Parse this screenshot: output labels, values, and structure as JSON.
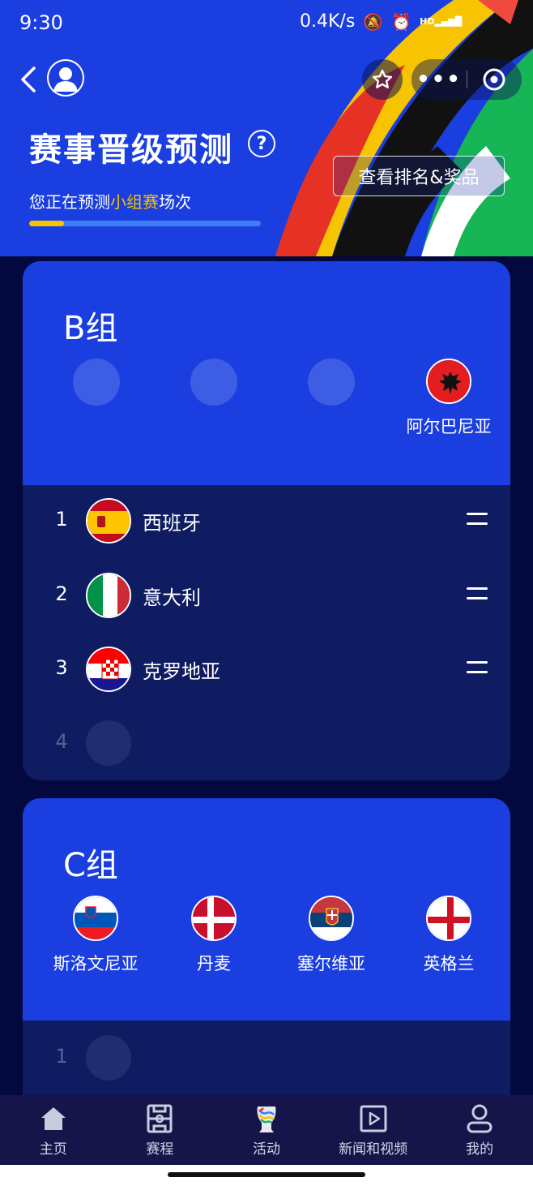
{
  "status_bar": {
    "time": "9:30",
    "speed": "0.4K/s",
    "signal_label": "HD"
  },
  "header": {
    "title": "赛事晋级预测",
    "subtitle_prefix": "您正在预测",
    "subtitle_highlight": "小组赛",
    "subtitle_suffix": "场次",
    "progress_fraction": 0.15,
    "rank_button": "查看排名&奖品"
  },
  "groups": [
    {
      "title": "B组",
      "remaining_teams": [
        {
          "name": "阿尔巴尼亚",
          "flag": "albania"
        }
      ],
      "ranking": [
        {
          "rank": "1",
          "name": "西班牙",
          "flag": "spain"
        },
        {
          "rank": "2",
          "name": "意大利",
          "flag": "italy"
        },
        {
          "rank": "3",
          "name": "克罗地亚",
          "flag": "croatia"
        },
        {
          "rank": "4",
          "name": "",
          "flag": ""
        }
      ]
    },
    {
      "title": "C组",
      "remaining_teams": [
        {
          "name": "斯洛文尼亚",
          "flag": "slovenia"
        },
        {
          "name": "丹麦",
          "flag": "denmark"
        },
        {
          "name": "塞尔维亚",
          "flag": "serbia"
        },
        {
          "name": "英格兰",
          "flag": "england"
        }
      ],
      "ranking": [
        {
          "rank": "1",
          "name": "",
          "flag": ""
        }
      ]
    }
  ],
  "tabbar": {
    "items": [
      {
        "label": "主页",
        "icon": "home-icon"
      },
      {
        "label": "赛程",
        "icon": "schedule-icon"
      },
      {
        "label": "活动",
        "icon": "trophy-icon"
      },
      {
        "label": "新闻和视频",
        "icon": "video-icon"
      },
      {
        "label": "我的",
        "icon": "profile-icon"
      }
    ]
  },
  "colors": {
    "primary": "#1a3ee0",
    "accent": "#f6c400",
    "card_bottom": "#0f1c62",
    "background": "#03093e"
  }
}
